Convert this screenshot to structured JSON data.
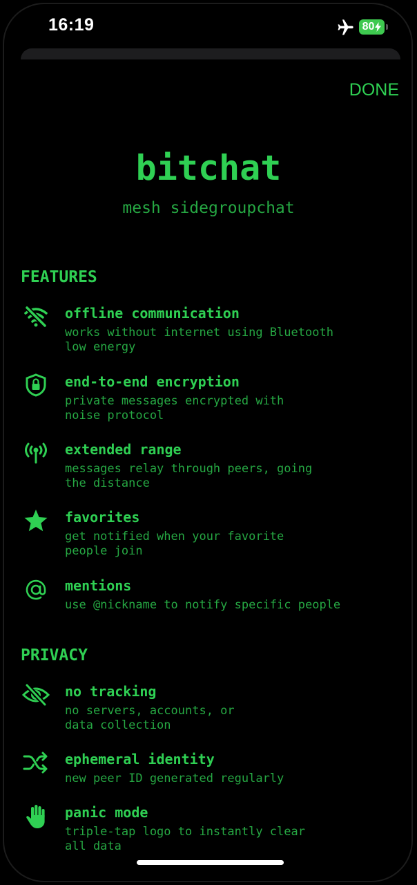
{
  "status": {
    "time": "16:19",
    "battery": "80"
  },
  "header": {
    "done_label": "DONE"
  },
  "app": {
    "title": "bitchat",
    "subtitle": "mesh sidegroupchat"
  },
  "features": {
    "header": "FEATURES",
    "items": [
      {
        "icon": "wifi-slash-icon",
        "title": "offline communication",
        "desc_line1": "works without internet using Bluetooth",
        "desc_line2": "low energy"
      },
      {
        "icon": "lock-shield-icon",
        "title": "end-to-end encryption",
        "desc_line1": "private messages encrypted with",
        "desc_line2": "noise protocol"
      },
      {
        "icon": "antenna-icon",
        "title": "extended range",
        "desc_line1": "messages relay through peers, going",
        "desc_line2": "the distance"
      },
      {
        "icon": "star-icon",
        "title": "favorites",
        "desc_line1": "get notified when your favorite",
        "desc_line2": "people join"
      },
      {
        "icon": "at-icon",
        "title": "mentions",
        "desc_line1": "use @nickname to notify specific people",
        "desc_line2": ""
      }
    ]
  },
  "privacy": {
    "header": "PRIVACY",
    "items": [
      {
        "icon": "eye-slash-icon",
        "title": "no tracking",
        "desc_line1": "no servers, accounts, or",
        "desc_line2": "data collection"
      },
      {
        "icon": "shuffle-icon",
        "title": "ephemeral identity",
        "desc_line1": "new peer ID generated regularly",
        "desc_line2": ""
      },
      {
        "icon": "hand-icon",
        "title": "panic mode",
        "desc_line1": "triple-tap logo to instantly clear",
        "desc_line2": "all data"
      }
    ]
  },
  "colors": {
    "accent": "#2fd053",
    "secondary": "#26a843",
    "background": "#000000"
  }
}
